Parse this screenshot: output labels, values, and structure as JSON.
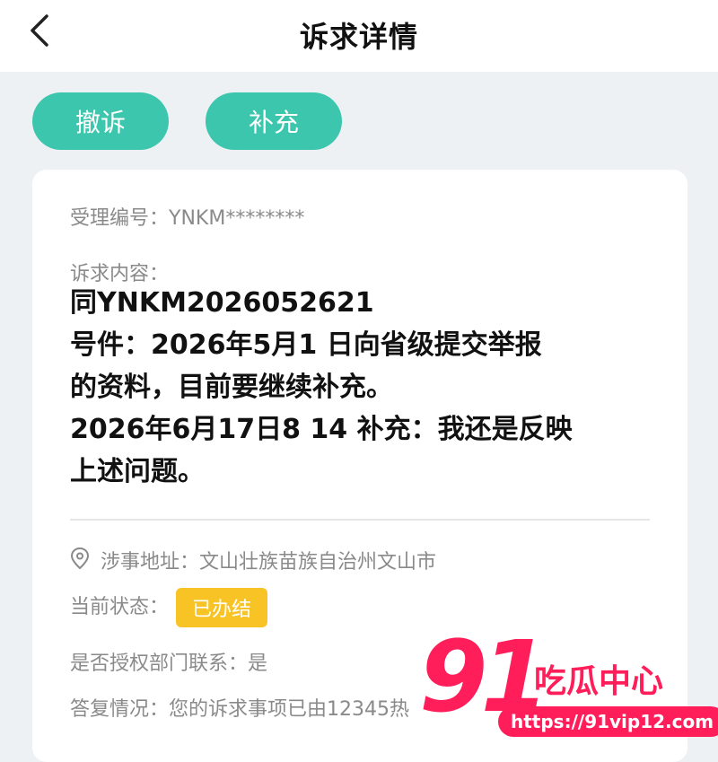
{
  "header": {
    "title": "诉求详情"
  },
  "actions": {
    "withdraw_label": "撤诉",
    "supplement_label": "补充"
  },
  "card": {
    "acceptance_no_label": "受理编号：",
    "acceptance_no_value": "YNKM********",
    "content_label": "诉求内容：",
    "content_lines": [
      "同YNKM20260526​21",
      "号件：2026年5月1 日向省级提交举报",
      "的资料，目前要继续补充。",
      "2026年6月17日8  14  补充：我还是反映",
      "上述问题。"
    ],
    "address_label": "涉事地址：",
    "address_value": "文山壮族苗族自治州文山市",
    "status_label": "当前状态：",
    "status_value": "已办结",
    "authorize_label": "是否授权部门联系：",
    "authorize_value": "是",
    "reply_label": "答复情况：",
    "reply_value": "您的诉求事项已由12345热"
  },
  "watermark": {
    "number": "91",
    "text": "吃瓜中心",
    "url": "https://91vip12.com"
  },
  "colors": {
    "accent": "#3cc6ad",
    "status_badge": "#f7c325",
    "watermark": "#ff1e5a"
  },
  "icons": {
    "back": "chevron-left-icon",
    "location": "location-pin-icon"
  }
}
